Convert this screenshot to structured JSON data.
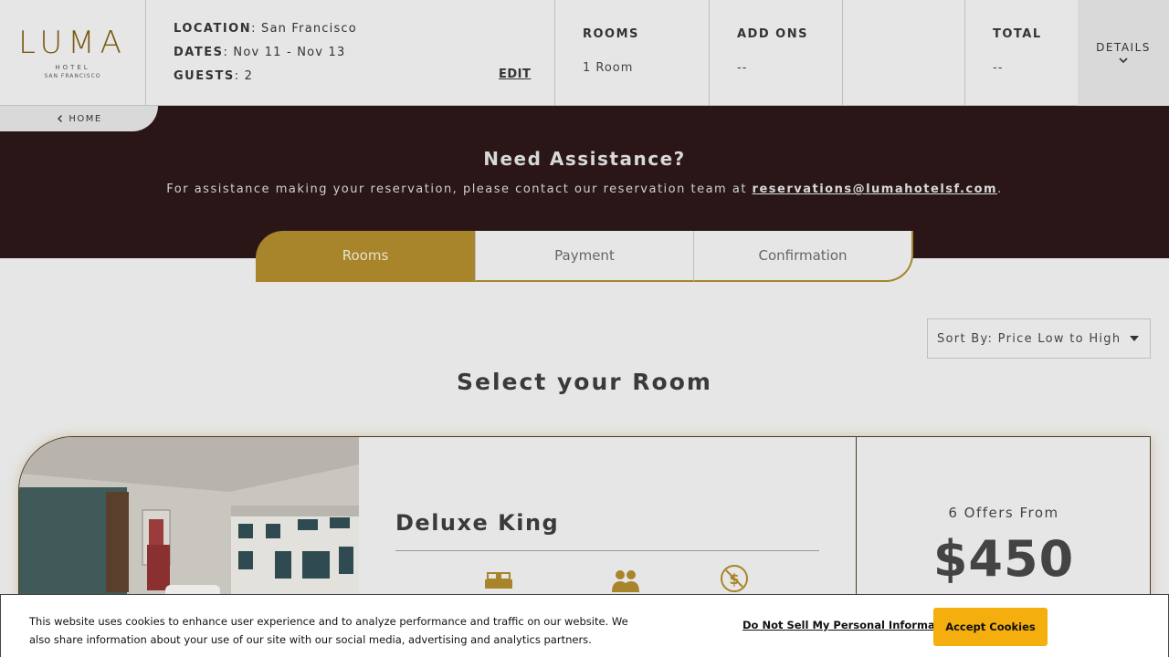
{
  "brand": {
    "logo": "LUMA",
    "logo_sub1": "HOTEL",
    "logo_sub2": "SAN FRANCISCO"
  },
  "trip": {
    "location_label": "LOCATION",
    "location_value": "San Francisco",
    "dates_label": "DATES",
    "dates_value": "Nov 11 - Nov 13",
    "guests_label": "GUESTS",
    "guests_value": "2",
    "edit_label": "EDIT"
  },
  "summary": {
    "rooms_label": "ROOMS",
    "rooms_value": "1 Room",
    "addons_label": "ADD ONS",
    "addons_value": "--",
    "total_label": "TOTAL",
    "total_value": "--",
    "details_label": "DETAILS"
  },
  "nav": {
    "home_label": "HOME"
  },
  "assist": {
    "title": "Need Assistance?",
    "text": "For assistance making your reservation, please contact our reservation team at ",
    "email": "reservations@lumahotelsf.com",
    "suffix": "."
  },
  "steps": [
    "Rooms",
    "Payment",
    "Confirmation"
  ],
  "sort": {
    "label": "Sort By: Price Low to High"
  },
  "page": {
    "title": "Select your Room"
  },
  "room": {
    "name": "Deluxe King",
    "offers_text": "6 Offers From",
    "price": "$450"
  },
  "cookie": {
    "message": "This website uses cookies to enhance user experience and to analyze performance and traffic on our website. We also share information about your use of our site with our social media, advertising and analytics partners.",
    "dns_label": "Do Not Sell My Personal Information",
    "accept_label": "Accept Cookies"
  },
  "colors": {
    "accent": "#a8842a",
    "band": "#2a1617",
    "cookie_button": "#f4ae0e"
  }
}
